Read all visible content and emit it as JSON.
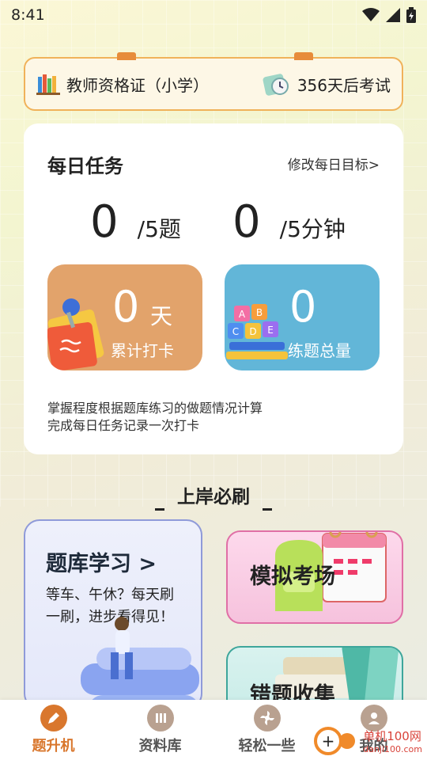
{
  "status_bar": {
    "time": "8:41"
  },
  "exam_banner": {
    "subject": "教师资格证（小学）",
    "countdown": "356天后考试"
  },
  "daily_task": {
    "title": "每日任务",
    "edit_goal": "修改每日目标>",
    "questions_done": "0",
    "questions_goal": "/5题",
    "minutes_done": "0",
    "minutes_goal": "/5分钟",
    "checkin_count": "0",
    "checkin_unit": "天",
    "checkin_label": "累计打卡",
    "practice_count": "0",
    "practice_label": "练题总量",
    "note_line1": "掌握程度根据题库练习的做题情况计算",
    "note_line2": "完成每日任务记录一次打卡"
  },
  "section": {
    "title": "上岸必刷"
  },
  "cards": {
    "study_title": "题库学习 >",
    "study_desc": "等车、午休？每天刷一刷，进步看得见！",
    "mock_title": "模拟考场",
    "wrong_title": "错题收集"
  },
  "tabs": [
    {
      "label": "题升机",
      "icon": "pencil-icon",
      "active": true
    },
    {
      "label": "资料库",
      "icon": "books-icon",
      "active": false
    },
    {
      "label": "轻松一些",
      "icon": "pinwheel-icon",
      "active": false
    },
    {
      "label": "我的",
      "icon": "profile-icon",
      "active": false
    }
  ],
  "watermark": {
    "text": "单机100网",
    "url_text": "danji100.com"
  },
  "colors": {
    "accent": "#d9772d",
    "orange_tile": "#e2a36b",
    "blue_tile": "#62b6d8"
  }
}
